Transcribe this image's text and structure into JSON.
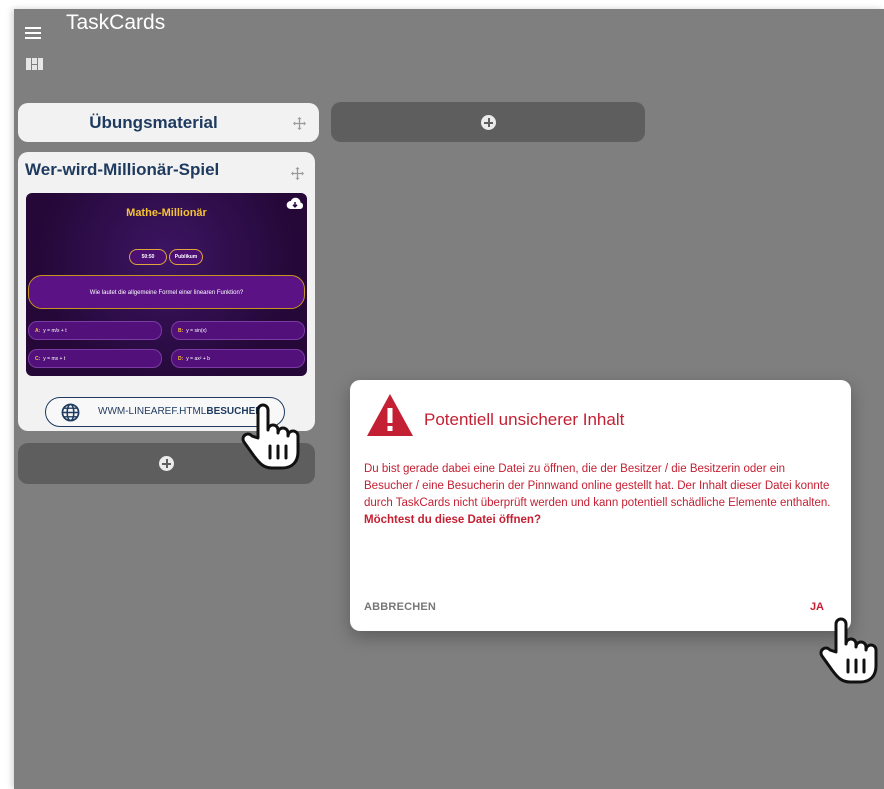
{
  "app": {
    "title": "TaskCards"
  },
  "column": {
    "title": "Übungsmaterial"
  },
  "card": {
    "title": "Wer-wird-Millionär-Spiel",
    "preview": {
      "title": "Mathe-Millionär",
      "jokers": [
        "50:50",
        "Publikum"
      ],
      "question": "Wie lautet die allgemeine Formel einer linearen Funktion?",
      "answers": [
        {
          "letter": "A:",
          "text": "y = m/x + t"
        },
        {
          "letter": "B:",
          "text": "y = sin(x)"
        },
        {
          "letter": "C:",
          "text": "y = mx + t"
        },
        {
          "letter": "D:",
          "text": "y = ax² + b"
        }
      ]
    },
    "link": {
      "filename": "WWM-LINEAREF.HTML",
      "action": "BESUCHEN"
    }
  },
  "dialog": {
    "title": "Potentiell unsicherer Inhalt",
    "body": "Du bist gerade dabei eine Datei zu öffnen, die der Besitzer / die Besitzerin oder ein Besucher / eine Besucherin der Pinnwand online gestellt hat. Der Inhalt dieser Datei konnte durch TaskCards nicht überprüft werden und kann potentiell schädliche Elemente enthalten.",
    "question": "Möchtest du diese Datei öffnen?",
    "cancel": "ABBRECHEN",
    "confirm": "JA"
  },
  "icons": {
    "menu": "hamburger-menu-icon",
    "layout": "board-layout-icon",
    "move": "move-arrows-icon",
    "add": "plus-circle-icon",
    "download": "cloud-download-icon",
    "globe": "globe-icon",
    "warning": "warning-triangle-icon",
    "cursor": "hand-pointer-cursor"
  },
  "colors": {
    "board": "#7f7f7f",
    "accent": "#1e3a5f",
    "danger": "#c42033",
    "gold": "#f6c331"
  }
}
